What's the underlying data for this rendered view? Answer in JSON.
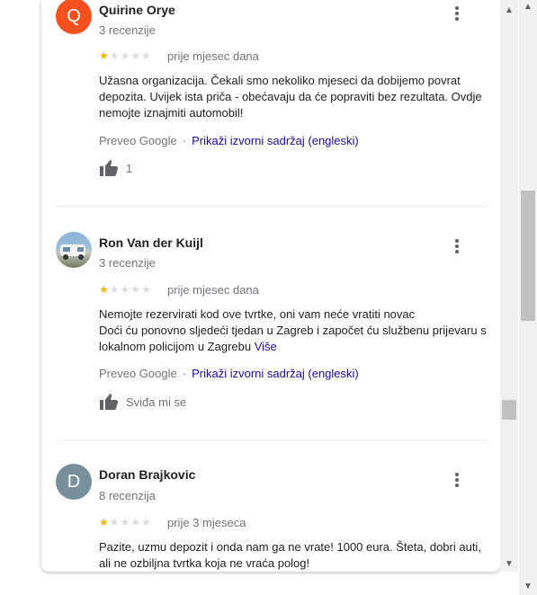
{
  "reviews": [
    {
      "avatar_letter": "Q",
      "avatar_color": "#f4511e",
      "name": "Quirine Orye",
      "count": "3 recenzije",
      "rating": 1,
      "date": "prije mjesec dana",
      "text_lines": [
        "Užasna organizacija. Čekali smo nekoliko mjeseci da dobijemo povrat",
        "depozita. Uvijek ista priča - obećavaju da će popraviti bez rezultata. Ovdje",
        "nemojte iznajmiti automobil!"
      ],
      "translated_by": "Preveo Google",
      "show_original": "Prikaži izvorni sadržaj (engleski)",
      "likes": "1"
    },
    {
      "avatar_letter": "",
      "avatar_color": "#7aa0c4",
      "name": "Ron Van der Kuijl",
      "count": "3 recenzije",
      "rating": 1,
      "date": "prije mjesec dana",
      "text_lines": [
        "Nemojte rezervirati kod ove tvrtke, oni vam neće vratiti novac",
        "Doći ću ponovno sljedeći tjedan u Zagreb i započet ću službenu prijevaru s",
        "lokalnom policijom u Zagrebu"
      ],
      "more": "Više",
      "translated_by": "Preveo Google",
      "show_original": "Prikaži izvorni sadržaj (engleski)",
      "like_label": "Sviđa mi se"
    },
    {
      "avatar_letter": "D",
      "avatar_color": "#78909c",
      "name": "Doran Brajkovic",
      "count": "8 recenzija",
      "rating": 1,
      "date": "prije 3 mjeseca",
      "text_lines": [
        "Pazite, uzmu depozit i onda nam ga ne vrate! 1000 eura. Šteta, dobri auti,",
        "ali ne ozbiljna tvrtka koja ne vraća polog!"
      ]
    }
  ],
  "icons": {
    "menu": "more-vert-icon",
    "thumb": "thumb-up-icon",
    "scroll_up": "chevron-up-icon",
    "scroll_down": "chevron-down-icon"
  }
}
